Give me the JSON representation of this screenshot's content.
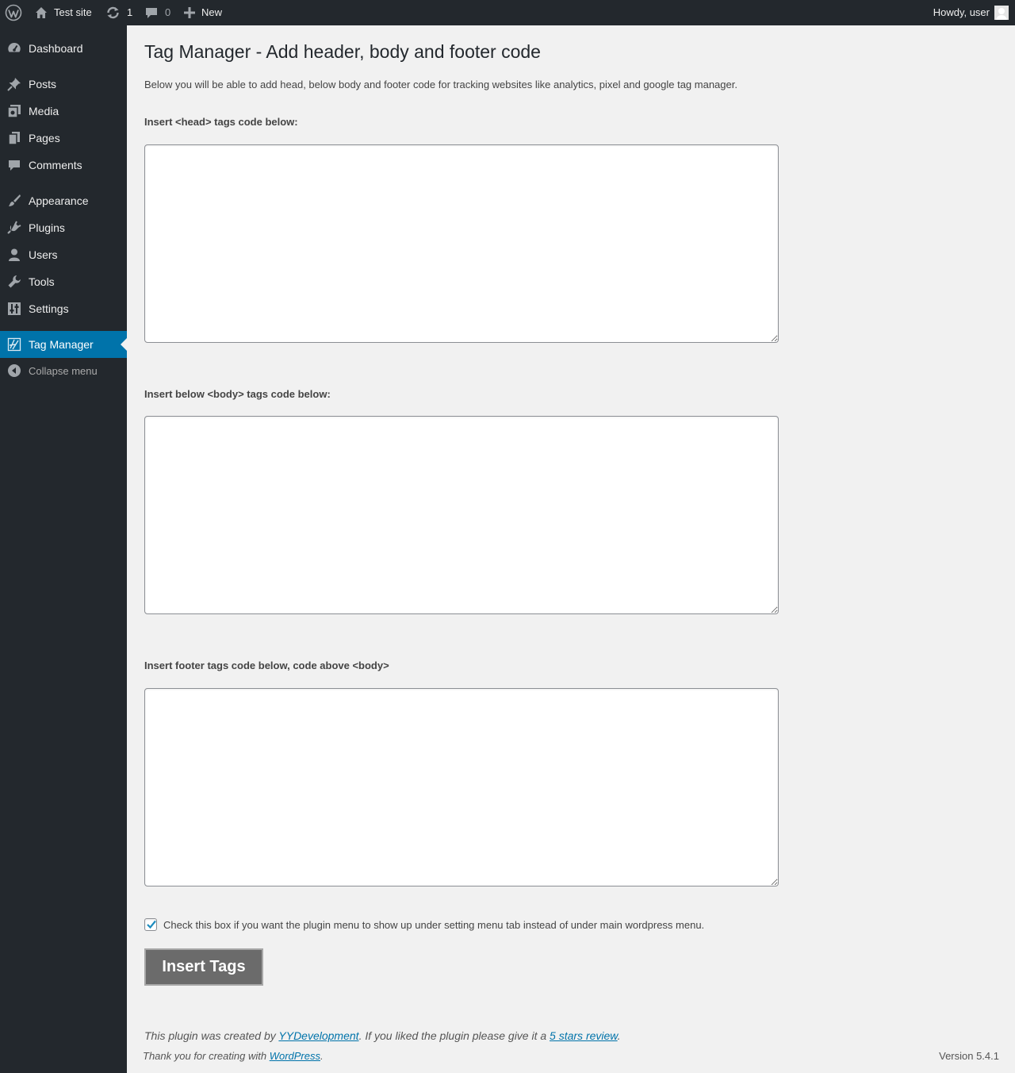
{
  "admin_bar": {
    "site_name": "Test site",
    "updates_count": "1",
    "comments_count": "0",
    "new_label": "New",
    "greeting": "Howdy, user"
  },
  "sidebar": {
    "items": [
      {
        "label": "Dashboard",
        "icon": "dashboard-icon"
      },
      {
        "label": "Posts",
        "icon": "pin-icon"
      },
      {
        "label": "Media",
        "icon": "media-icon"
      },
      {
        "label": "Pages",
        "icon": "pages-icon"
      },
      {
        "label": "Comments",
        "icon": "comment-icon"
      },
      {
        "label": "Appearance",
        "icon": "brush-icon"
      },
      {
        "label": "Plugins",
        "icon": "plug-icon"
      },
      {
        "label": "Users",
        "icon": "user-icon"
      },
      {
        "label": "Tools",
        "icon": "wrench-icon"
      },
      {
        "label": "Settings",
        "icon": "settings-icon"
      },
      {
        "label": "Tag Manager",
        "icon": "tag-manager-icon",
        "current": true
      }
    ],
    "collapse_label": "Collapse menu"
  },
  "main": {
    "title": "Tag Manager - Add header, body and footer code",
    "description": "Below you will be able to add head, below body and footer code for tracking websites like analytics, pixel and google tag manager.",
    "fields": [
      {
        "label": "Insert <head> tags code below:",
        "value": ""
      },
      {
        "label": "Insert below <body> tags code below:",
        "value": ""
      },
      {
        "label": "Insert footer tags code below, code above <body>",
        "value": ""
      }
    ],
    "checkbox_label": "Check this box if you want the plugin menu to show up under setting menu tab instead of under main wordpress menu.",
    "checkbox_checked": true,
    "submit_label": "Insert Tags",
    "credit_prefix": "This plugin was created by ",
    "credit_link": "YYDevelopment",
    "credit_middle": ". If you liked the plugin please give it a ",
    "review_link": "5 stars review",
    "credit_suffix": "."
  },
  "footer": {
    "thanks_prefix": "Thank you for creating with ",
    "thanks_link": "WordPress",
    "thanks_suffix": ".",
    "version": "Version 5.4.1"
  },
  "colors": {
    "admin_bar_bg": "#23282d",
    "accent": "#0073aa",
    "page_bg": "#f1f1f1"
  }
}
